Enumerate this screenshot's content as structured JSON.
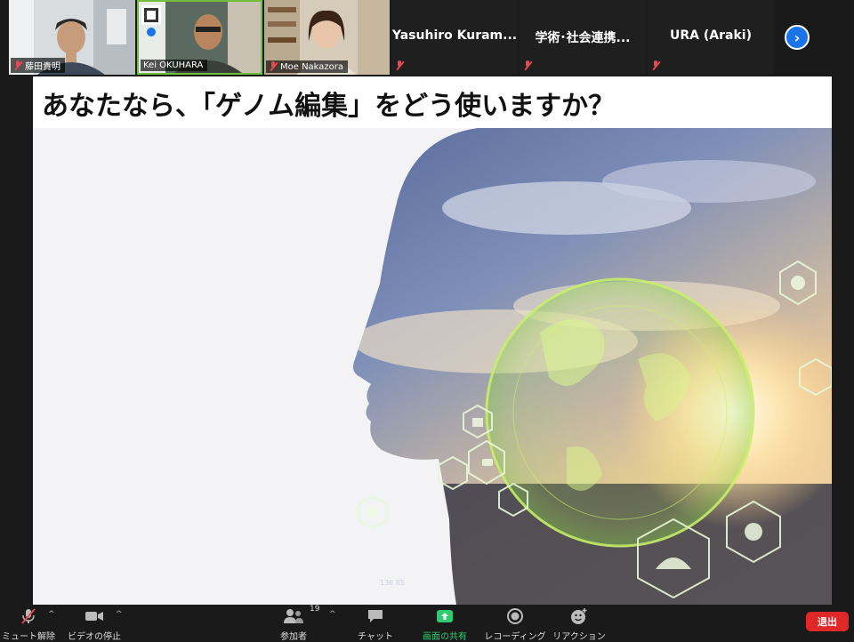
{
  "participants": [
    {
      "name": "藤田貴明",
      "muted": true
    },
    {
      "name": "Kei OKUHARA",
      "muted": false
    },
    {
      "name": "Moe Nakazora",
      "muted": true
    }
  ],
  "name_tiles": [
    {
      "name": "Yasuhiro Kuram...",
      "muted": true
    },
    {
      "name": "学術･社会連携...",
      "muted": true
    },
    {
      "name": "URA (Araki)",
      "muted": true
    }
  ],
  "slide": {
    "title": "あなたなら、「ゲノム編集」をどう使いますか？"
  },
  "toolbar": {
    "mute_label": "ミュート解除",
    "video_label": "ビデオの停止",
    "participants_label": "参加者",
    "participants_count": "19",
    "chat_label": "チャット",
    "share_label": "画面の共有",
    "record_label": "レコーディング",
    "reaction_label": "リアクション",
    "end_label": "退出"
  },
  "colors": {
    "share_green": "#2ecc71",
    "end_red": "#e02828",
    "accent_blue": "#1a73e8"
  }
}
